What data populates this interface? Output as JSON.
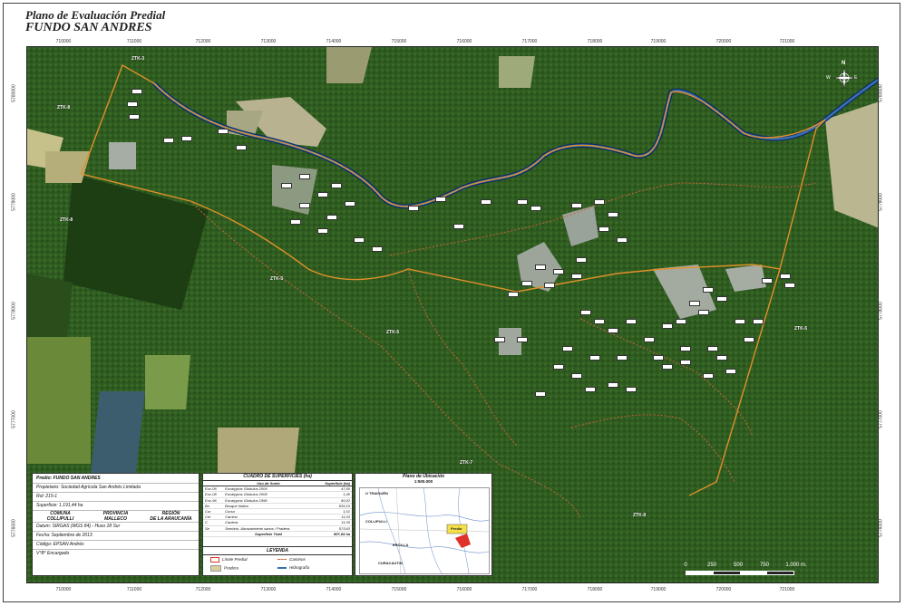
{
  "header": {
    "title": "Plano de Evaluación Predial",
    "subtitle": "FUNDO SAN ANDRES"
  },
  "grid": {
    "x_ticks": [
      "710000",
      "711000",
      "712000",
      "713000",
      "714000",
      "715000",
      "716000",
      "717000",
      "718000",
      "719000",
      "720000",
      "721000"
    ],
    "y_ticks": [
      "5780000",
      "5779000",
      "5778000",
      "5777000",
      "5776000"
    ]
  },
  "map": {
    "zones": [
      "ZTK-3",
      "ZTK-8",
      "ZTK-8",
      "ZTK-5",
      "ZTK-5",
      "ZTK-5",
      "ZTK-7",
      "ZTK-8"
    ],
    "colors": {
      "forest": "#2e5a1e",
      "river": "#3a6fb0",
      "boundary": "#d08a2a",
      "road": "#c8643a",
      "pradera": "#d9cfa0",
      "plantation": "#9aa59a"
    }
  },
  "info": {
    "predio": "Predio: FUNDO SAN ANDRES",
    "propietario": "Propietario: Sociedad Agrícola San Andrés Limitada",
    "rol": "Rol: 215-1",
    "superficie": "Superficie: 1.191,44 ha",
    "comuna_h": "COMUNA",
    "comuna": "COLLIPULLI",
    "provincia_h": "PROVINCIA",
    "provincia": "MALLECO",
    "region_h": "REGIÓN",
    "region": "DE LA ARAUCANÍA",
    "datum": "Datum: SIRGAS (WGS 84) - Huso 18 Sur",
    "fecha": "Fecha: Septiembre de 2013",
    "codigo": "Código: EPSAN Andrés",
    "vb": "V°B° Encargado"
  },
  "superficies": {
    "title": "CUADRO DE SUPERFICIES (ha)",
    "col_uso": "Uso de Suelo",
    "col_sup": "Superficie (ha)",
    "rows": [
      {
        "code": "Euc-06",
        "uso": "Eucalyptus Globulus 2006",
        "sup": "47,60"
      },
      {
        "code": "Euc-08",
        "uso": "Eucalyptus Globulus 2008",
        "sup": "1,40"
      },
      {
        "code": "Euc-96",
        "uso": "Eucalyptus Globulus 1996",
        "sup": "60,02"
      },
      {
        "code": "Bn",
        "uso": "Bosque Nativo",
        "sup": "835,10"
      },
      {
        "code": "Cur",
        "uso": "Cursa",
        "sup": "1,01"
      },
      {
        "code": "Cer",
        "uso": "Camino",
        "sup": "11,03"
      },
      {
        "code": "C",
        "uso": "Cantera",
        "sup": "11,00"
      },
      {
        "code": "Se",
        "uso": "Sembrío, Abrazamiento sanos / Pradera",
        "sup": "57/143"
      }
    ],
    "total_label": "Superficie Total",
    "total": "907,84 ha"
  },
  "leyenda": {
    "title": "LEYENDA",
    "limite": "Límite Predial",
    "caminos": "Caminos",
    "pradera": "Pradera",
    "hidrografia": "Hidrografía"
  },
  "ubicacion": {
    "title": "Plano de Ubicación",
    "scale": "1:500.000",
    "places": [
      "U TRAIGUÉN",
      "COLLIPULLI",
      "ERCILLA",
      "CURACAUTIN",
      "Predio"
    ]
  },
  "scale": {
    "labels": [
      "0",
      "250",
      "500",
      "750",
      "1.000 m."
    ]
  },
  "compass": {
    "n": "N",
    "e": "E",
    "w": "W"
  }
}
